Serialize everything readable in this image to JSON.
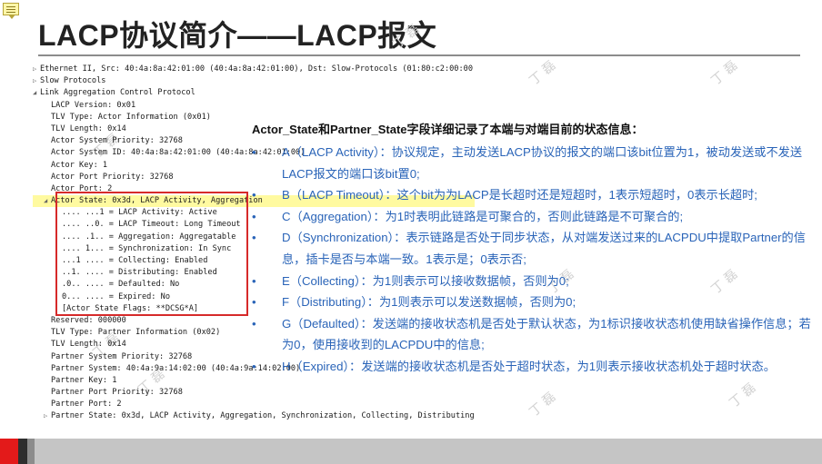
{
  "title": "LACP协议简介——LACP报文",
  "watermark": "丁 磊",
  "packet_tree": [
    {
      "indent": 0,
      "toggle": "▷",
      "text": "Ethernet II, Src: 40:4a:8a:42:01:00 (40:4a:8a:42:01:00), Dst: Slow-Protocols (01:80:c2:00:00:02)"
    },
    {
      "indent": 0,
      "toggle": "▷",
      "text": "Slow Protocols"
    },
    {
      "indent": 0,
      "toggle": "◢",
      "text": "Link Aggregation Control Protocol"
    },
    {
      "indent": 1,
      "toggle": "",
      "text": "LACP Version: 0x01"
    },
    {
      "indent": 1,
      "toggle": "",
      "text": "TLV Type: Actor Information (0x01)"
    },
    {
      "indent": 1,
      "toggle": "",
      "text": "TLV Length: 0x14"
    },
    {
      "indent": 1,
      "toggle": "",
      "text": "Actor System Priority: 32768"
    },
    {
      "indent": 1,
      "toggle": "",
      "text": "Actor System ID: 40:4a:8a:42:01:00 (40:4a:8a:42:01:00)"
    },
    {
      "indent": 1,
      "toggle": "",
      "text": "Actor Key: 1"
    },
    {
      "indent": 1,
      "toggle": "",
      "text": "Actor Port Priority: 32768"
    },
    {
      "indent": 1,
      "toggle": "",
      "text": "Actor Port: 2"
    },
    {
      "indent": 1,
      "toggle": "◢",
      "text": "Actor State: 0x3d, LACP Activity, Aggregation",
      "selected": true
    },
    {
      "indent": 2,
      "toggle": "",
      "text": ".... ...1 = LACP Activity: Active"
    },
    {
      "indent": 2,
      "toggle": "",
      "text": ".... ..0. = LACP Timeout: Long Timeout"
    },
    {
      "indent": 2,
      "toggle": "",
      "text": ".... .1.. = Aggregation: Aggregatable"
    },
    {
      "indent": 2,
      "toggle": "",
      "text": ".... 1... = Synchronization: In Sync"
    },
    {
      "indent": 2,
      "toggle": "",
      "text": "...1 .... = Collecting: Enabled"
    },
    {
      "indent": 2,
      "toggle": "",
      "text": "..1. .... = Distributing: Enabled"
    },
    {
      "indent": 2,
      "toggle": "",
      "text": ".0.. .... = Defaulted: No"
    },
    {
      "indent": 2,
      "toggle": "",
      "text": "0... .... = Expired: No"
    },
    {
      "indent": 2,
      "toggle": "",
      "text": "[Actor State Flags: **DCSG*A]"
    },
    {
      "indent": 1,
      "toggle": "",
      "text": "Reserved: 000000"
    },
    {
      "indent": 1,
      "toggle": "",
      "text": "TLV Type: Partner Information (0x02)"
    },
    {
      "indent": 1,
      "toggle": "",
      "text": "TLV Length: 0x14"
    },
    {
      "indent": 1,
      "toggle": "",
      "text": "Partner System Priority: 32768"
    },
    {
      "indent": 1,
      "toggle": "",
      "text": "Partner System: 40:4a:9a:14:02:00 (40:4a:9a:14:02:00)"
    },
    {
      "indent": 1,
      "toggle": "",
      "text": "Partner Key: 1"
    },
    {
      "indent": 1,
      "toggle": "",
      "text": "Partner Port Priority: 32768"
    },
    {
      "indent": 1,
      "toggle": "",
      "text": "Partner Port: 2"
    },
    {
      "indent": 1,
      "toggle": "▷",
      "text": "Partner State: 0x3d, LACP Activity, Aggregation, Synchronization, Collecting, Distributing"
    }
  ],
  "panel": {
    "heading": "Actor_State和Partner_State字段详细记录了本端与对端目前的状态信息：",
    "bullets": [
      "A（LACP Activity）：协议规定，主动发送LACP协议的报文的端口该bit位置为1，被动发送或不发送LACP报文的端口该bit置0;",
      "B（LACP Timeout）：这个bit为为LACP是长超时还是短超时，1表示短超时，0表示长超时;",
      "C（Aggregation）：为1时表明此链路是可聚合的，否则此链路是不可聚合的;",
      "D（Synchronization）：表示链路是否处于同步状态，从对端发送过来的LACPDU中提取Partner的信息，插卡是否与本端一致。1表示是；0表示否;",
      "E（Collecting）：为1则表示可以接收数据帧，否则为0;",
      "F（Distributing）：为1则表示可以发送数据帧，否则为0;",
      "G（Defaulted）：发送端的接收状态机是否处于默认状态，为1标识接收状态机使用缺省操作信息；若为0，使用接收到的LACPDU中的信息;",
      "H（Expired）：发送端的接收状态机是否处于超时状态，为1则表示接收状态机处于超时状态。"
    ]
  },
  "colors": {
    "bullet": "#2a64b8",
    "highlight_box": "#d62a2a",
    "selected_row": "#fffaa0",
    "footer_red": "#e31a1a"
  }
}
